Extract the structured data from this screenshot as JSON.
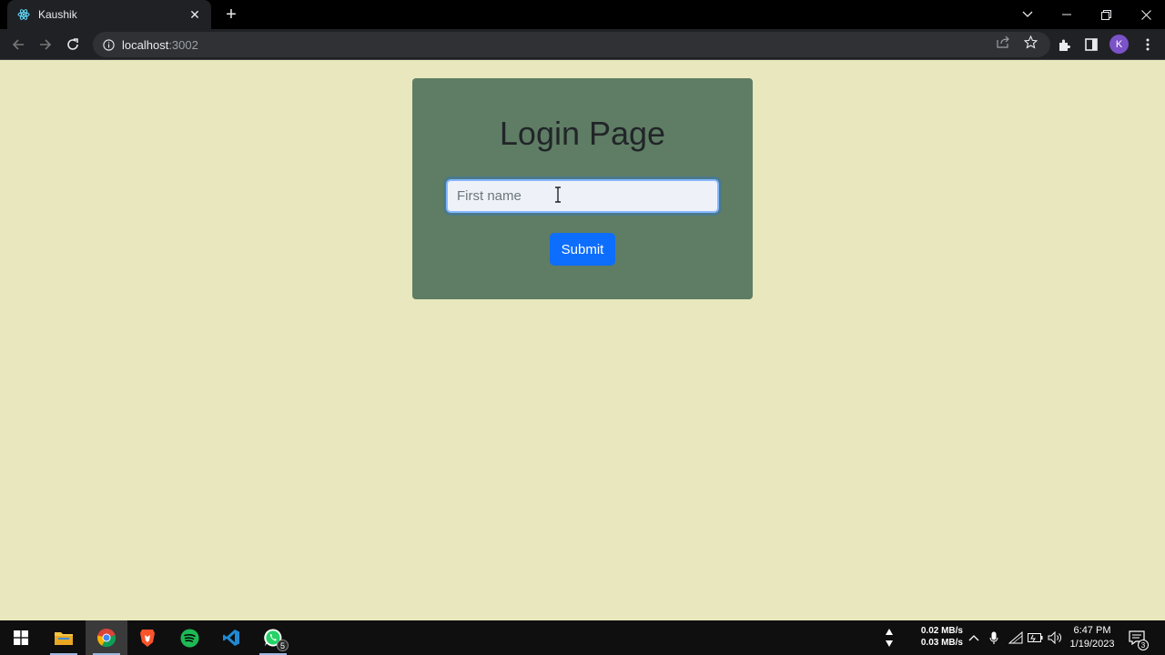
{
  "browser": {
    "tab_title": "Kaushik",
    "url_host": "localhost",
    "url_port": ":3002",
    "profile_initial": "K"
  },
  "page": {
    "heading": "Login Page",
    "input_placeholder": "First name",
    "submit_label": "Submit"
  },
  "taskbar": {
    "whatsapp_badge": "5",
    "net_up": "0.02 MB/s",
    "net_down": "0.03 MB/s",
    "time": "6:47 PM",
    "date": "1/19/2023",
    "notifications": "3"
  },
  "colors": {
    "page_bg": "#e9e7bd",
    "card_bg": "#5f7d64",
    "button_bg": "#0d6efd"
  }
}
